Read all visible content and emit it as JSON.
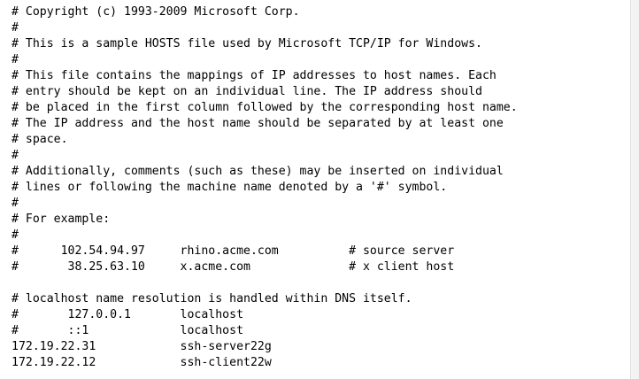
{
  "editor": {
    "lines": [
      "# Copyright (c) 1993-2009 Microsoft Corp.",
      "#",
      "# This is a sample HOSTS file used by Microsoft TCP/IP for Windows.",
      "#",
      "# This file contains the mappings of IP addresses to host names. Each",
      "# entry should be kept on an individual line. The IP address should",
      "# be placed in the first column followed by the corresponding host name.",
      "# The IP address and the host name should be separated by at least one",
      "# space.",
      "#",
      "# Additionally, comments (such as these) may be inserted on individual",
      "# lines or following the machine name denoted by a '#' symbol.",
      "#",
      "# For example:",
      "#",
      "#      102.54.94.97     rhino.acme.com          # source server",
      "#       38.25.63.10     x.acme.com              # x client host",
      "",
      "# localhost name resolution is handled within DNS itself.",
      "#       127.0.0.1       localhost",
      "#       ::1             localhost",
      "172.19.22.31            ssh-server22g",
      "172.19.22.12            ssh-client22w"
    ]
  }
}
